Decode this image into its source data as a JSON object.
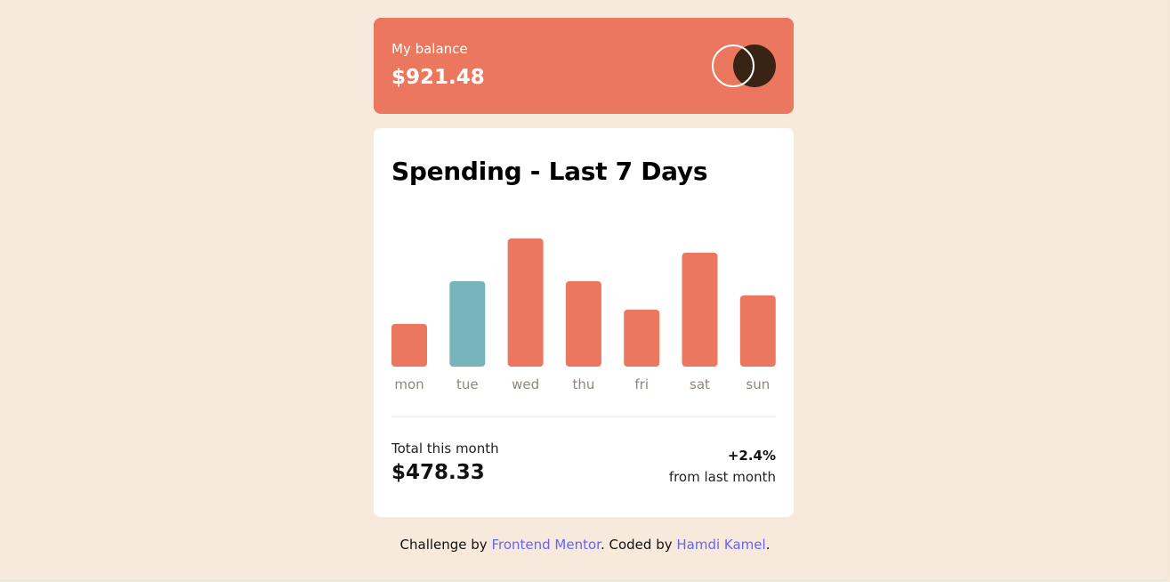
{
  "balance": {
    "label": "My balance",
    "amount": "$921.48"
  },
  "spending": {
    "title": "Spending - Last 7 Days",
    "total_label": "Total this month",
    "total_amount": "$478.33",
    "change": "+2.4%",
    "change_label": "from last month"
  },
  "chart_data": {
    "type": "bar",
    "categories": [
      "mon",
      "tue",
      "wed",
      "thu",
      "fri",
      "sat",
      "sun"
    ],
    "values": [
      3,
      6,
      9,
      6,
      4,
      8,
      5
    ],
    "highlight_index": 1,
    "ylim": [
      0,
      9
    ],
    "grid": false,
    "colors": {
      "bar": "#ec775f",
      "highlight": "#76b5bc",
      "label": "#92857a"
    }
  },
  "footer": {
    "prefix": "Challenge by",
    "link1": "Frontend Mentor",
    "middle": ". Coded by",
    "link2": "Hamdi Kamel",
    "suffix": "."
  },
  "colors": {
    "background": "#f8e9dd",
    "accent": "#ec775f",
    "logo_dark": "#382314",
    "link": "#6766f0"
  }
}
